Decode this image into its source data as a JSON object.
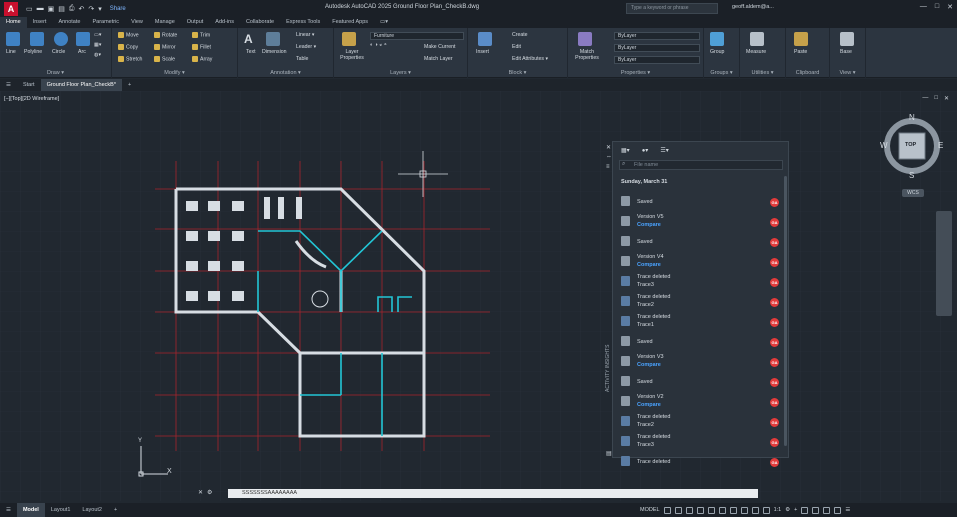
{
  "window": {
    "app_logo": "A",
    "title": "Autodesk AutoCAD 2025   Ground Floor Plan_CheckB.dwg",
    "share": "Share",
    "search_placeholder": "Type a keyword or phrase",
    "user": "geoff.aldem@a...",
    "controls": [
      "—",
      "□",
      "✕"
    ]
  },
  "ribbon_tabs": [
    "Home",
    "Insert",
    "Annotate",
    "Parametric",
    "View",
    "Manage",
    "Output",
    "Add-ins",
    "Collaborate",
    "Express Tools",
    "Featured Apps",
    "▭▾"
  ],
  "active_ribbon_tab": "Home",
  "panels": {
    "draw": {
      "label": "Draw ▾",
      "buttons": [
        "Line",
        "Polyline",
        "Circle",
        "Arc"
      ]
    },
    "modify": {
      "label": "Modify ▾",
      "buttons": [
        "Move",
        "Rotate",
        "Trim",
        "Copy",
        "Mirror",
        "Fillet",
        "Stretch",
        "Scale",
        "Array"
      ]
    },
    "annotation": {
      "label": "Annotation ▾",
      "buttons": [
        "Text",
        "Dimension",
        "Linear ▾",
        "Leader ▾",
        "Table"
      ]
    },
    "layers": {
      "label": "Layers ▾",
      "layer_props": "Layer Properties",
      "current_layer": "Furniture",
      "buttons": [
        "Make Current",
        "Match Layer"
      ]
    },
    "block": {
      "label": "Block ▾",
      "buttons": [
        "Insert",
        "Create",
        "Edit",
        "Edit Attributes ▾"
      ]
    },
    "properties": {
      "label": "Properties ▾",
      "match": "Match Properties",
      "bylayer1": "ByLayer",
      "bylayer2": "ByLayer",
      "bylayer3": "ByLayer"
    },
    "groups": {
      "label": "Groups ▾",
      "button": "Group"
    },
    "utilities": {
      "label": "Utilities ▾",
      "button": "Measure"
    },
    "clipboard": {
      "label": "Clipboard",
      "button": "Paste"
    },
    "view": {
      "label": "View ▾",
      "button": "Base"
    }
  },
  "doc_tabs": [
    "Start",
    "Ground Floor Plan_CheckB*"
  ],
  "active_doc_tab": "Ground Floor Plan_CheckB*",
  "viewport": {
    "label": "[−][Top][2D Wireframe]",
    "controls": [
      "—",
      "□",
      "✕"
    ],
    "viewcube": {
      "top": "TOP",
      "n": "N",
      "s": "S",
      "e": "E",
      "w": "W",
      "wcs": "WCS"
    }
  },
  "activity_panel": {
    "title": "ACTIVITY INSIGHTS",
    "search_placeholder": "File name",
    "date": "Sunday, March 31",
    "items": [
      {
        "title": "Saved",
        "sub": "",
        "type": "save",
        "user": "GA"
      },
      {
        "title": "Version V5",
        "sub": "Compare",
        "type": "version",
        "user": "GA"
      },
      {
        "title": "Saved",
        "sub": "",
        "type": "save",
        "user": "GA"
      },
      {
        "title": "Version V4",
        "sub": "Compare",
        "type": "version",
        "user": "GA"
      },
      {
        "title": "Trace deleted",
        "sub": "Trace3",
        "type": "trace",
        "user": "GA"
      },
      {
        "title": "Trace deleted",
        "sub": "Trace2",
        "type": "trace",
        "user": "GA"
      },
      {
        "title": "Trace deleted",
        "sub": "Trace1",
        "type": "trace",
        "user": "GA"
      },
      {
        "title": "Saved",
        "sub": "",
        "type": "save",
        "user": "GA"
      },
      {
        "title": "Version V3",
        "sub": "Compare",
        "type": "version",
        "user": "GA"
      },
      {
        "title": "Saved",
        "sub": "",
        "type": "save",
        "user": "GA"
      },
      {
        "title": "Version V2",
        "sub": "Compare",
        "type": "version",
        "user": "GA"
      },
      {
        "title": "Trace deleted",
        "sub": "Trace2",
        "type": "trace",
        "user": "GA"
      },
      {
        "title": "Trace deleted",
        "sub": "Trace3",
        "type": "trace",
        "user": "GA"
      },
      {
        "title": "Trace deleted",
        "sub": "",
        "type": "trace",
        "user": "GA"
      }
    ]
  },
  "command_line": {
    "text": "SSSSSSSAAAAAAAA"
  },
  "layout_tabs": [
    "Model",
    "Layout1",
    "Layout2",
    "+"
  ],
  "active_layout": "Model",
  "status": {
    "model": "MODEL",
    "scale": "1:1"
  },
  "colors": {
    "accent": "#4aa3ff",
    "wall": "#d7dde3",
    "grid_red": "#a8242c",
    "cyan": "#22c6d6",
    "avatar": "#e23b3b"
  }
}
